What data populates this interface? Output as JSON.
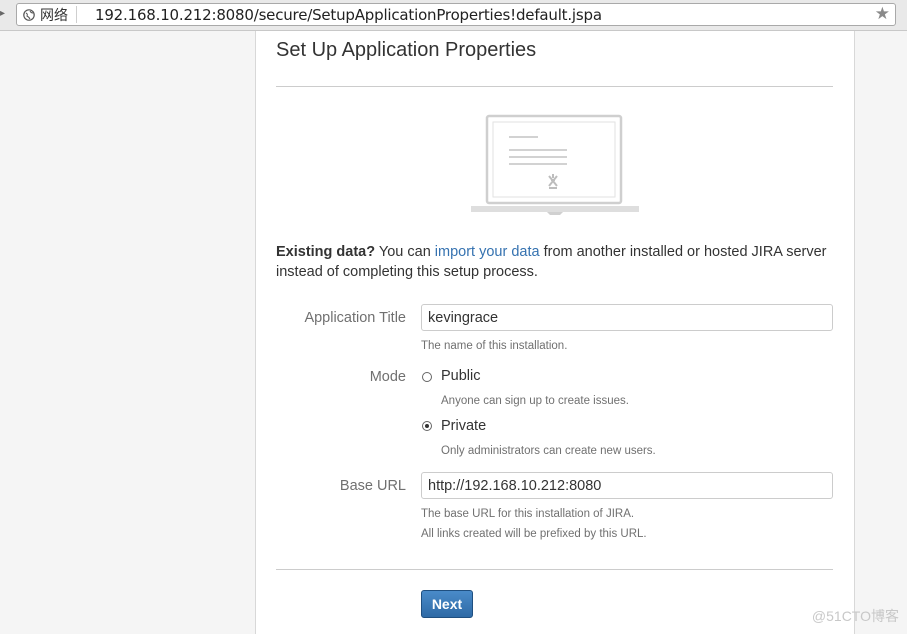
{
  "browser": {
    "site_label": "网络",
    "url": "192.168.10.212:8080/secure/SetupApplicationProperties!default.jspa"
  },
  "page": {
    "title": "Set Up Application Properties"
  },
  "intro": {
    "lead": "Existing data?",
    "pre": " You can ",
    "link": "import your data",
    "post": " from another installed or hosted JIRA server instead of completing this setup process."
  },
  "form": {
    "app_title": {
      "label": "Application Title",
      "value": "kevingrace",
      "help": "The name of this installation."
    },
    "mode": {
      "label": "Mode",
      "options": [
        {
          "label": "Public",
          "help": "Anyone can sign up to create issues.",
          "selected": false
        },
        {
          "label": "Private",
          "help": "Only administrators can create new users.",
          "selected": true
        }
      ]
    },
    "base_url": {
      "label": "Base URL",
      "value": "http://192.168.10.212:8080",
      "help_line1": "The base URL for this installation of JIRA.",
      "help_line2": "All links created will be prefixed by this URL."
    },
    "next_label": "Next"
  },
  "watermark": "@51CTO博客",
  "colors": {
    "link": "#3572b0",
    "button": "#3572b0",
    "label": "#707070"
  }
}
